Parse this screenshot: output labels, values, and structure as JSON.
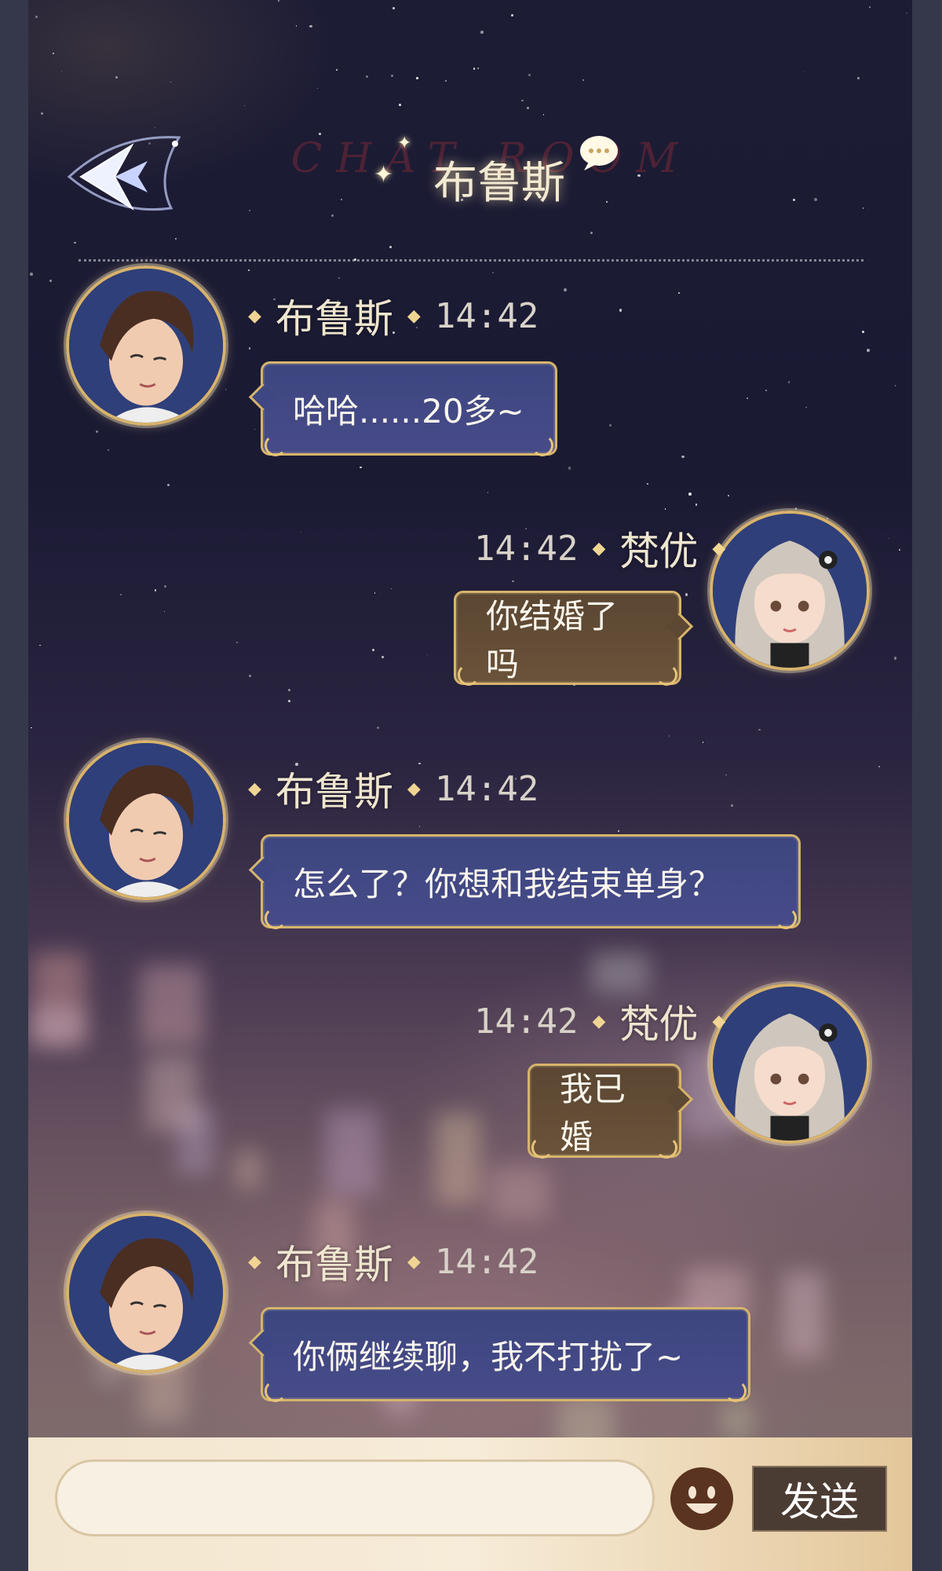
{
  "header": {
    "title": "布鲁斯",
    "watermark": "CHAT ROOM",
    "back_icon": "back-arrow-icon",
    "chat_icon": "speech-bubble-icon"
  },
  "messages": [
    {
      "side": "left",
      "name": "布鲁斯",
      "time": "14:42",
      "text": "哈哈......20多~"
    },
    {
      "side": "right",
      "name": "梵优",
      "time": "14:42",
      "text": "你结婚了吗"
    },
    {
      "side": "left",
      "name": "布鲁斯",
      "time": "14:42",
      "text": "怎么了？你想和我结束单身？"
    },
    {
      "side": "right",
      "name": "梵优",
      "time": "14:42",
      "text": "我已婚"
    },
    {
      "side": "left",
      "name": "布鲁斯",
      "time": "14:42",
      "text": "你俩继续聊，我不打扰了~"
    }
  ],
  "input": {
    "value": "",
    "placeholder": ""
  },
  "emoji_icon": "smiley-face-icon",
  "send_label": "发送",
  "colors": {
    "gold_border": "#d6b46b",
    "left_bubble": "#3f4782",
    "right_bubble": "#5d4833",
    "send_button": "#4b3c33"
  }
}
